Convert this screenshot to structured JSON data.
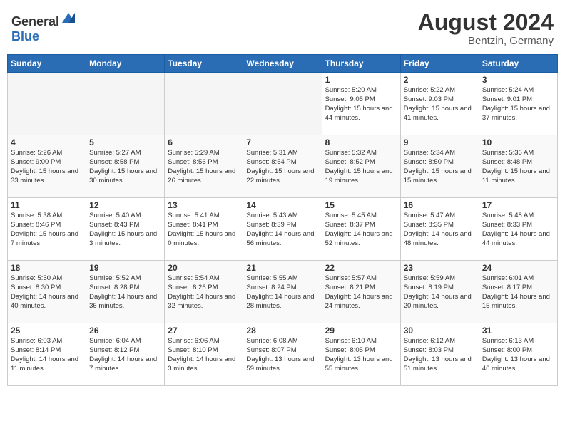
{
  "header": {
    "logo_general": "General",
    "logo_blue": "Blue",
    "month_year": "August 2024",
    "location": "Bentzin, Germany"
  },
  "weekdays": [
    "Sunday",
    "Monday",
    "Tuesday",
    "Wednesday",
    "Thursday",
    "Friday",
    "Saturday"
  ],
  "weeks": [
    [
      {
        "day": "",
        "empty": true
      },
      {
        "day": "",
        "empty": true
      },
      {
        "day": "",
        "empty": true
      },
      {
        "day": "",
        "empty": true
      },
      {
        "day": "1",
        "sunrise": "5:20 AM",
        "sunset": "9:05 PM",
        "daylight": "15 hours and 44 minutes."
      },
      {
        "day": "2",
        "sunrise": "5:22 AM",
        "sunset": "9:03 PM",
        "daylight": "15 hours and 41 minutes."
      },
      {
        "day": "3",
        "sunrise": "5:24 AM",
        "sunset": "9:01 PM",
        "daylight": "15 hours and 37 minutes."
      }
    ],
    [
      {
        "day": "4",
        "sunrise": "5:26 AM",
        "sunset": "9:00 PM",
        "daylight": "15 hours and 33 minutes."
      },
      {
        "day": "5",
        "sunrise": "5:27 AM",
        "sunset": "8:58 PM",
        "daylight": "15 hours and 30 minutes."
      },
      {
        "day": "6",
        "sunrise": "5:29 AM",
        "sunset": "8:56 PM",
        "daylight": "15 hours and 26 minutes."
      },
      {
        "day": "7",
        "sunrise": "5:31 AM",
        "sunset": "8:54 PM",
        "daylight": "15 hours and 22 minutes."
      },
      {
        "day": "8",
        "sunrise": "5:32 AM",
        "sunset": "8:52 PM",
        "daylight": "15 hours and 19 minutes."
      },
      {
        "day": "9",
        "sunrise": "5:34 AM",
        "sunset": "8:50 PM",
        "daylight": "15 hours and 15 minutes."
      },
      {
        "day": "10",
        "sunrise": "5:36 AM",
        "sunset": "8:48 PM",
        "daylight": "15 hours and 11 minutes."
      }
    ],
    [
      {
        "day": "11",
        "sunrise": "5:38 AM",
        "sunset": "8:46 PM",
        "daylight": "15 hours and 7 minutes."
      },
      {
        "day": "12",
        "sunrise": "5:40 AM",
        "sunset": "8:43 PM",
        "daylight": "15 hours and 3 minutes."
      },
      {
        "day": "13",
        "sunrise": "5:41 AM",
        "sunset": "8:41 PM",
        "daylight": "15 hours and 0 minutes."
      },
      {
        "day": "14",
        "sunrise": "5:43 AM",
        "sunset": "8:39 PM",
        "daylight": "14 hours and 56 minutes."
      },
      {
        "day": "15",
        "sunrise": "5:45 AM",
        "sunset": "8:37 PM",
        "daylight": "14 hours and 52 minutes."
      },
      {
        "day": "16",
        "sunrise": "5:47 AM",
        "sunset": "8:35 PM",
        "daylight": "14 hours and 48 minutes."
      },
      {
        "day": "17",
        "sunrise": "5:48 AM",
        "sunset": "8:33 PM",
        "daylight": "14 hours and 44 minutes."
      }
    ],
    [
      {
        "day": "18",
        "sunrise": "5:50 AM",
        "sunset": "8:30 PM",
        "daylight": "14 hours and 40 minutes."
      },
      {
        "day": "19",
        "sunrise": "5:52 AM",
        "sunset": "8:28 PM",
        "daylight": "14 hours and 36 minutes."
      },
      {
        "day": "20",
        "sunrise": "5:54 AM",
        "sunset": "8:26 PM",
        "daylight": "14 hours and 32 minutes."
      },
      {
        "day": "21",
        "sunrise": "5:55 AM",
        "sunset": "8:24 PM",
        "daylight": "14 hours and 28 minutes."
      },
      {
        "day": "22",
        "sunrise": "5:57 AM",
        "sunset": "8:21 PM",
        "daylight": "14 hours and 24 minutes."
      },
      {
        "day": "23",
        "sunrise": "5:59 AM",
        "sunset": "8:19 PM",
        "daylight": "14 hours and 20 minutes."
      },
      {
        "day": "24",
        "sunrise": "6:01 AM",
        "sunset": "8:17 PM",
        "daylight": "14 hours and 15 minutes."
      }
    ],
    [
      {
        "day": "25",
        "sunrise": "6:03 AM",
        "sunset": "8:14 PM",
        "daylight": "14 hours and 11 minutes."
      },
      {
        "day": "26",
        "sunrise": "6:04 AM",
        "sunset": "8:12 PM",
        "daylight": "14 hours and 7 minutes."
      },
      {
        "day": "27",
        "sunrise": "6:06 AM",
        "sunset": "8:10 PM",
        "daylight": "14 hours and 3 minutes."
      },
      {
        "day": "28",
        "sunrise": "6:08 AM",
        "sunset": "8:07 PM",
        "daylight": "13 hours and 59 minutes."
      },
      {
        "day": "29",
        "sunrise": "6:10 AM",
        "sunset": "8:05 PM",
        "daylight": "13 hours and 55 minutes."
      },
      {
        "day": "30",
        "sunrise": "6:12 AM",
        "sunset": "8:03 PM",
        "daylight": "13 hours and 51 minutes."
      },
      {
        "day": "31",
        "sunrise": "6:13 AM",
        "sunset": "8:00 PM",
        "daylight": "13 hours and 46 minutes."
      }
    ]
  ],
  "labels": {
    "sunrise": "Sunrise:",
    "sunset": "Sunset:",
    "daylight": "Daylight:"
  }
}
